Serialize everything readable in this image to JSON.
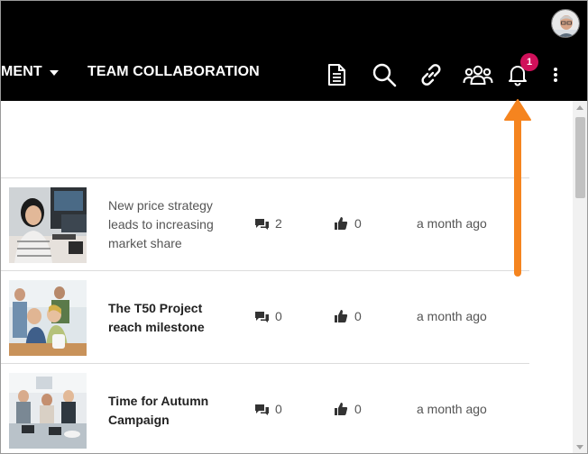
{
  "nav": {
    "items": [
      {
        "label": "MENT"
      },
      {
        "label": "TEAM COLLABORATION"
      }
    ]
  },
  "toolbar": {
    "icons": [
      "document-icon",
      "search-icon",
      "link-icon",
      "users-icon",
      "bell-icon",
      "more-vertical-icon"
    ],
    "notification_count": "1"
  },
  "feed": {
    "items": [
      {
        "title": "New price strategy leads to increasing market share",
        "comments": "2",
        "likes": "0",
        "time": "a month ago"
      },
      {
        "title": "The T50 Project reach milestone",
        "comments": "0",
        "likes": "0",
        "time": "a month ago"
      },
      {
        "title": "Time for Autumn Campaign",
        "comments": "0",
        "likes": "0",
        "time": "a month ago"
      }
    ]
  },
  "colors": {
    "topbar": "#000000",
    "badge": "#d0105a",
    "annotation_arrow": "#f5841f"
  }
}
